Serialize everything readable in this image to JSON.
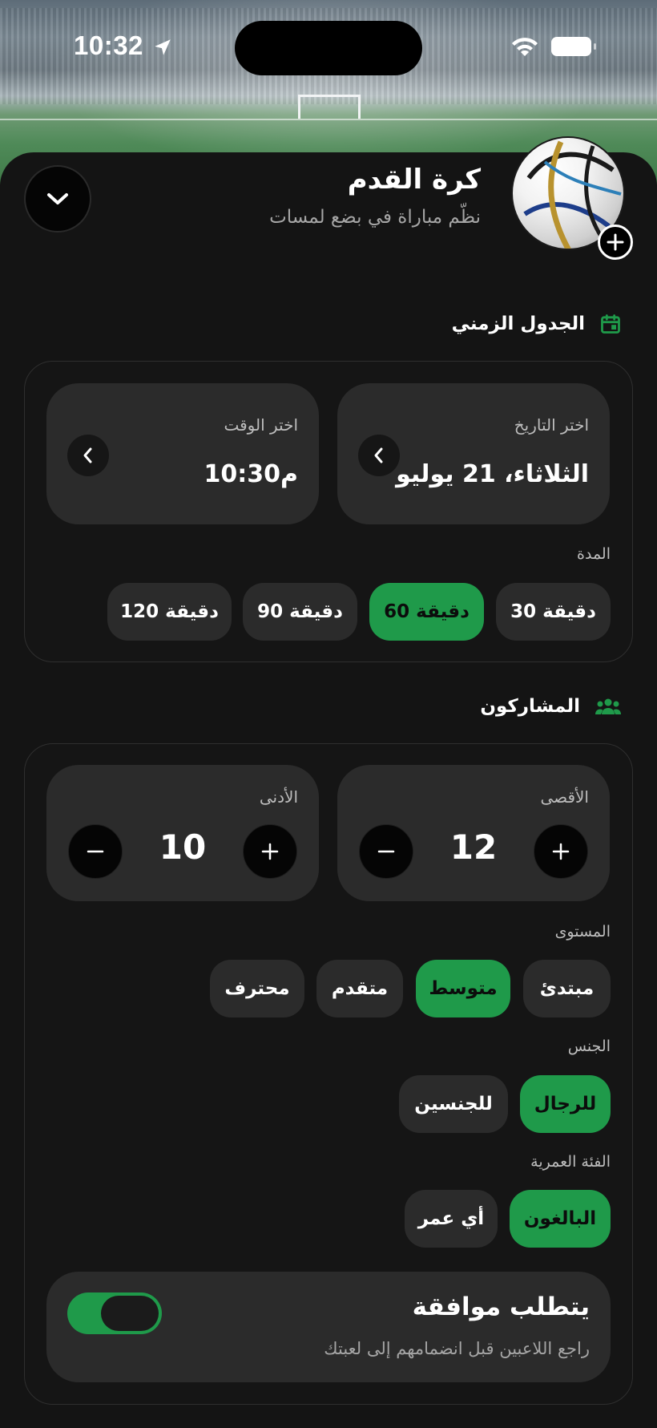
{
  "status_bar": {
    "time": "10:32"
  },
  "header": {
    "title": "كرة القدم",
    "subtitle": "نظّم مباراة في بضع لمسات"
  },
  "schedule": {
    "section_title": "الجدول الزمني",
    "date_label": "اختر التاريخ",
    "date_value": "الثلاثاء، 21 يوليو",
    "time_label": "اختر الوقت",
    "time_value": "10:30م",
    "duration_label": "المدة",
    "durations": [
      "30 دقيقة",
      "60 دقيقة",
      "90 دقيقة",
      "120 دقيقة"
    ],
    "selected_duration": "60 دقيقة"
  },
  "participants": {
    "section_title": "المشاركون",
    "max_label": "الأقصى",
    "max_value": "12",
    "min_label": "الأدنى",
    "min_value": "10",
    "level_label": "المستوى",
    "levels": [
      "مبتدئ",
      "متوسط",
      "متقدم",
      "محترف"
    ],
    "selected_level": "متوسط",
    "gender_label": "الجنس",
    "genders": [
      "للرجال",
      "للجنسين"
    ],
    "selected_gender": "للرجال",
    "age_label": "الفئة العمرية",
    "ages": [
      "البالغون",
      "أي عمر"
    ],
    "selected_age": "البالغون"
  },
  "approval": {
    "title": "يتطلب موافقة",
    "subtitle": "راجع اللاعبين قبل انضمامهم إلى لعبتك",
    "enabled": true
  },
  "colors": {
    "accent": "#1f9a4a",
    "background": "#141414",
    "tile": "#2b2b2b"
  }
}
